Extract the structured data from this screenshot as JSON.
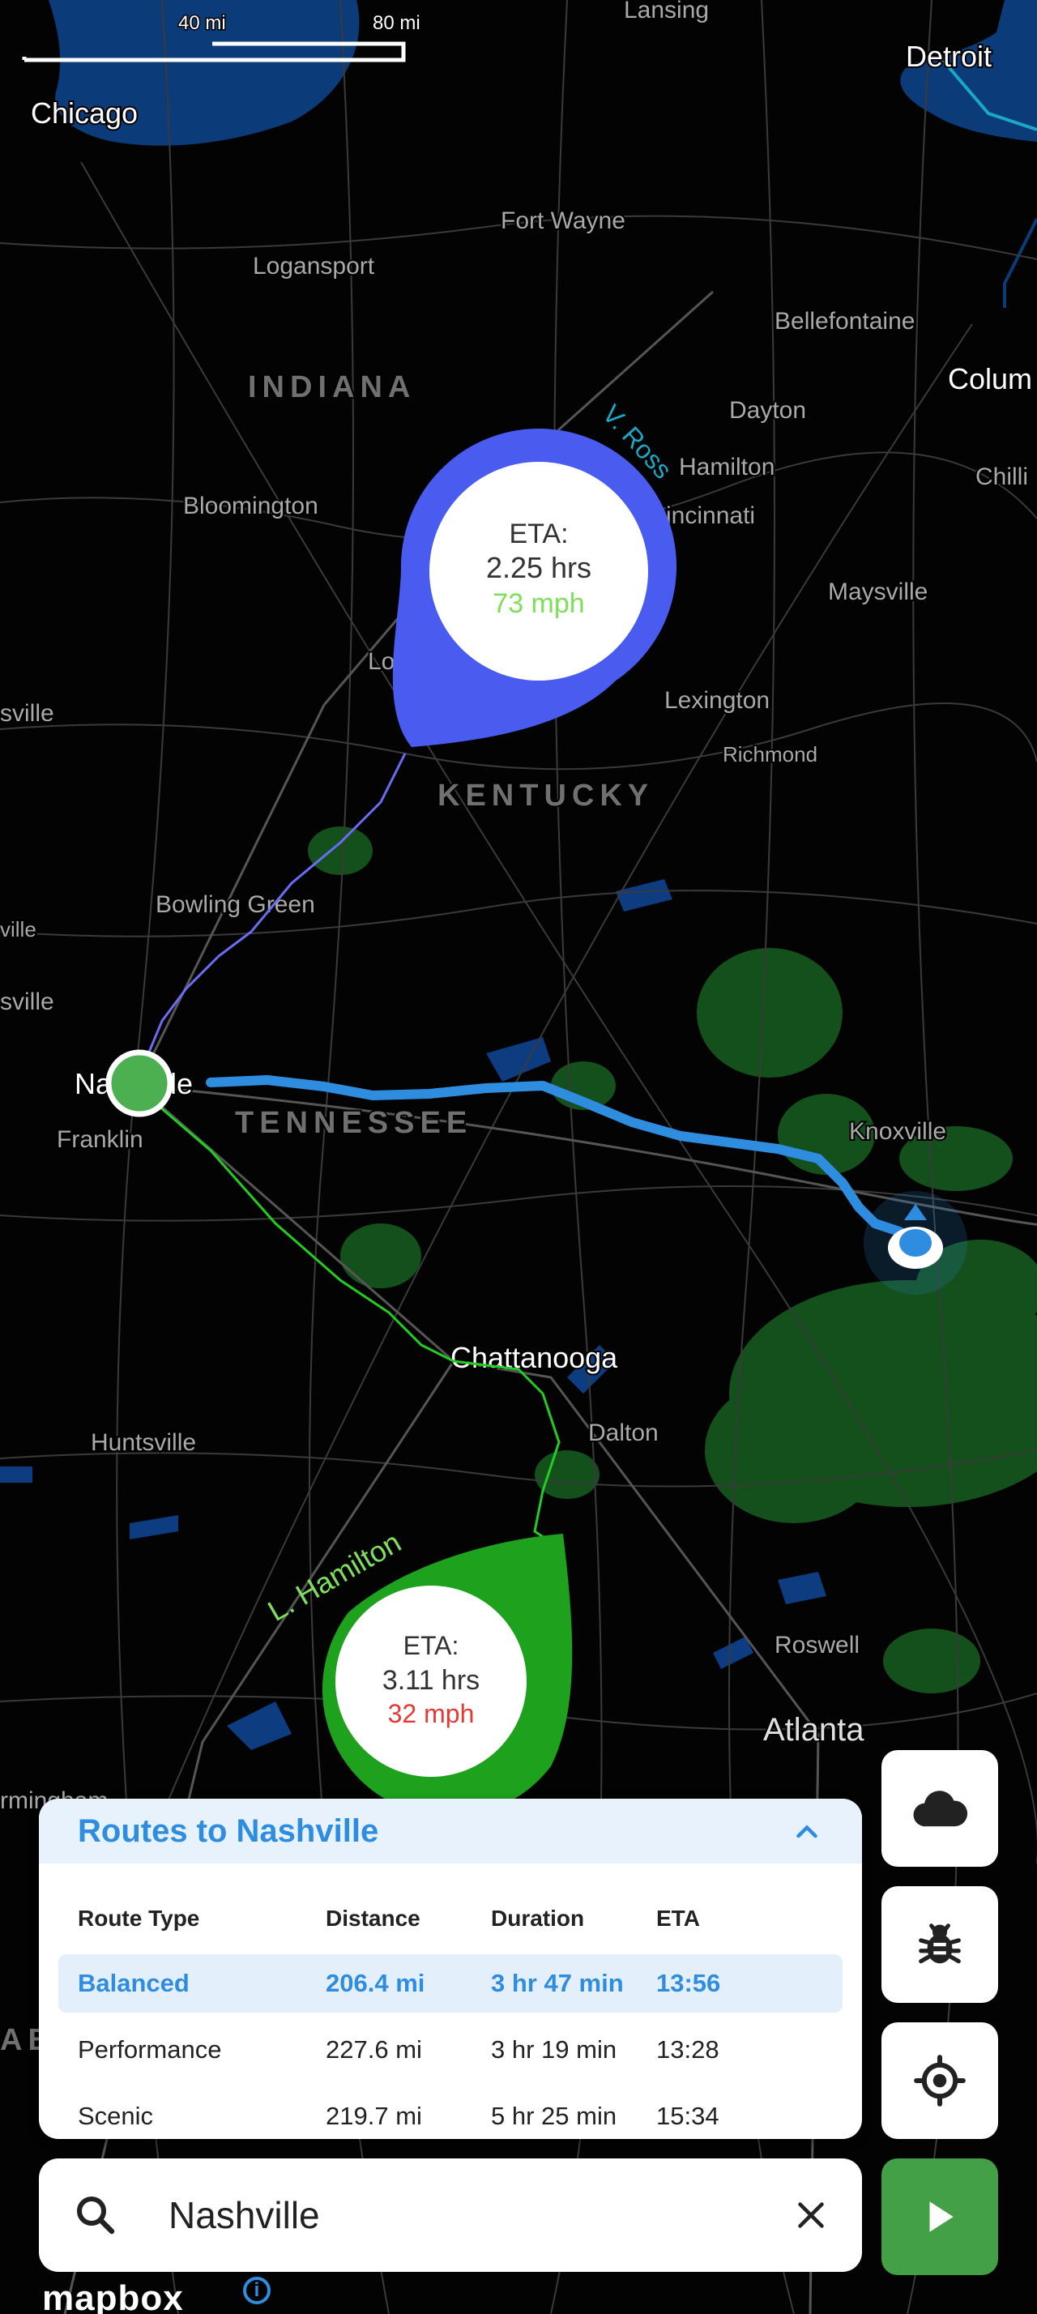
{
  "map": {
    "scale": {
      "left_label": "40 mi",
      "right_label": "80 mi"
    },
    "labels": {
      "lansing": "Lansing",
      "detroit": "Detroit",
      "chicago": "Chicago",
      "fort_wayne": "Fort Wayne",
      "logansport": "Logansport",
      "bellefontaine": "Bellefontaine",
      "indiana": "INDIANA",
      "columbus": "Colum",
      "dayton": "Dayton",
      "hamilton": "Hamilton",
      "chilli": "Chilli",
      "bloomington": "Bloomington",
      "cincinnati": "incinnati",
      "maysville": "Maysville",
      "louisville": "Lou",
      "lexington": "Lexington",
      "richmond": "Richmond",
      "sville_edge": "sville",
      "kentucky": "KENTUCKY",
      "bowling_green": "Bowling Green",
      "ville_edge": "ville",
      "sville_edge2": "sville",
      "nashville": "Nashville",
      "franklin": "Franklin",
      "tennessee": "TENNESSEE",
      "knoxville": "Knoxville",
      "chattanooga": "Chattanooga",
      "dalton": "Dalton",
      "huntsville": "Huntsville",
      "roswell": "Roswell",
      "atlanta": "Atlanta",
      "birmingham": "rmingham",
      "ab_edge": "AB"
    },
    "road_labels": {
      "v_ross": "V. Ross",
      "l_hamilton": "L. Hamilton"
    },
    "callouts": {
      "blue": {
        "label": "ETA:",
        "eta": "2.25 hrs",
        "speed": "73 mph",
        "color": "#4a5cf0",
        "speed_color": "#7ee05a"
      },
      "green": {
        "label": "ETA:",
        "eta": "3.11 hrs",
        "speed": "32 mph",
        "color": "#1ea21e",
        "speed_color": "#e53935"
      }
    },
    "route_color": "#2f8de0",
    "marker_color": "#4caf50"
  },
  "routes_panel": {
    "title": "Routes to Nashville",
    "headers": {
      "type": "Route Type",
      "distance": "Distance",
      "duration": "Duration",
      "eta": "ETA"
    },
    "rows": [
      {
        "type": "Balanced",
        "distance": "206.4 mi",
        "duration": "3 hr 47 min",
        "eta": "13:56"
      },
      {
        "type": "Performance",
        "distance": "227.6 mi",
        "duration": "3 hr 19 min",
        "eta": "13:28"
      },
      {
        "type": "Scenic",
        "distance": "219.7 mi",
        "duration": "5 hr 25 min",
        "eta": "15:34"
      }
    ]
  },
  "search": {
    "value": "Nashville"
  },
  "footer": {
    "brand": "mapbox",
    "info": "i"
  }
}
